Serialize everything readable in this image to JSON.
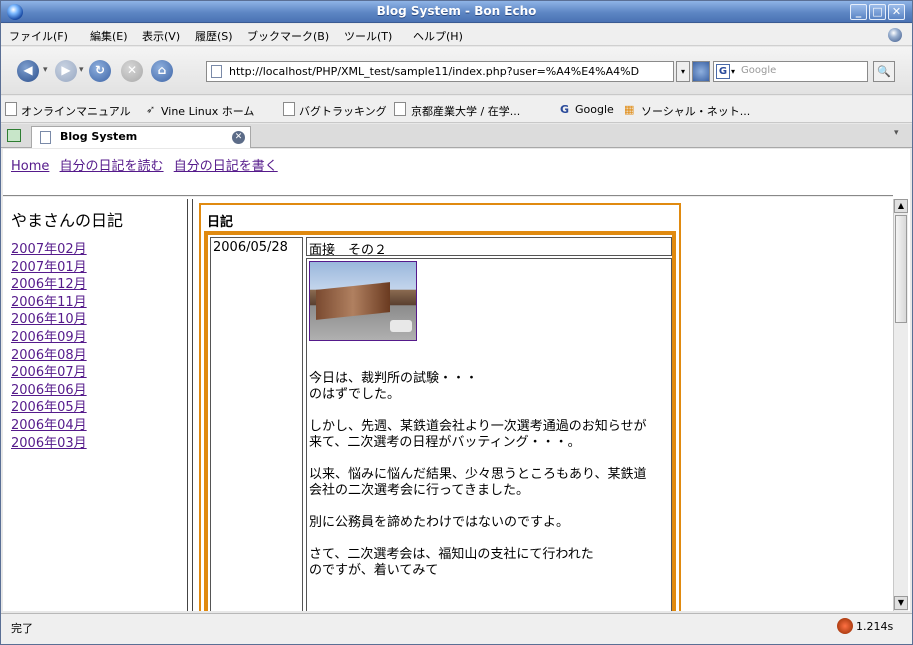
{
  "window": {
    "title": "Blog System - Bon Echo"
  },
  "menu": [
    "ファイル(F)",
    "編集(E)",
    "表示(V)",
    "履歴(S)",
    "ブックマーク(B)",
    "ツール(T)",
    "ヘルプ(H)"
  ],
  "nav": {
    "url": "http://localhost/PHP/XML_test/sample11/index.php?user=%A4%E4%A4%D",
    "search_placeholder": "Google",
    "search_engine_icon": "G"
  },
  "bookmarks": [
    "オンラインマニュアル",
    "Vine Linux ホーム",
    "バグトラッキング",
    "京都産業大学 / 在学...",
    "Google",
    "ソーシャル・ネット..."
  ],
  "tab": {
    "label": "Blog System"
  },
  "page": {
    "links": [
      "Home",
      "自分の日記を読む",
      "自分の日記を書く"
    ],
    "owner_title": "やまさんの日記",
    "months": [
      "2007年02月",
      "2007年01月",
      "2006年12月",
      "2006年11月",
      "2006年10月",
      "2006年09月",
      "2006年08月",
      "2006年07月",
      "2006年06月",
      "2006年05月",
      "2006年04月",
      "2006年03月"
    ],
    "diary_heading": "日記",
    "entry": {
      "date": "2006/05/28",
      "title": "面接　その２",
      "body": "今日は、裁判所の試験・・・\nのはずでした。\n\nしかし、先週、某鉄道会社より一次選考通過のお知らせが\n来て、二次選考の日程がバッティング・・・。\n\n以来、悩みに悩んだ結果、少々思うところもあり、某鉄道\n会社の二次選考会に行ってきました。\n\n別に公務員を諦めたわけではないのですよ。\n\nさて、二次選考会は、福知山の支社にて行われた\nのですが、着いてみて"
    }
  },
  "status": {
    "text": "完了",
    "time": "1.214s"
  }
}
